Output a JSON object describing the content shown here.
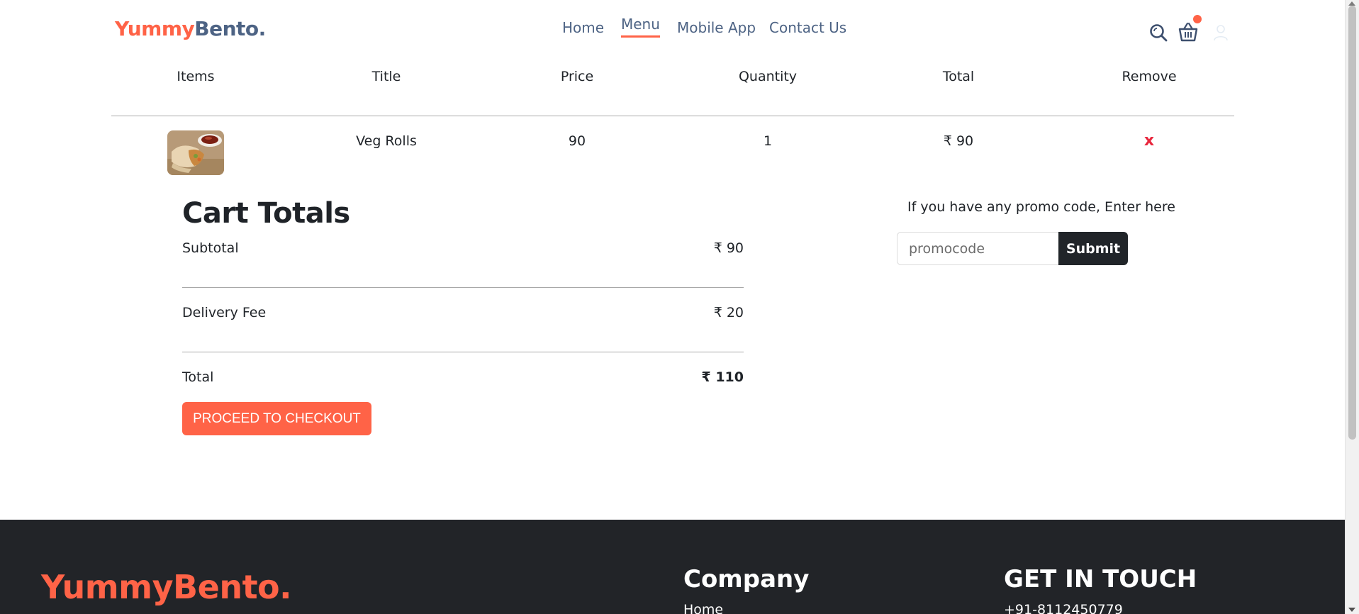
{
  "brand": {
    "name_part1": "Yummy",
    "name_part2": "Bento.",
    "accent": "#ff6347",
    "secondary": "#4d6384"
  },
  "nav": {
    "items": [
      {
        "label": "Home"
      },
      {
        "label": "Menu",
        "active": true
      },
      {
        "label": "Mobile App"
      },
      {
        "label": "Contact Us"
      }
    ],
    "icons": [
      "search-icon",
      "basket-icon",
      "user-icon"
    ],
    "cart_has_items": true
  },
  "cart": {
    "headers": [
      "Items",
      "Title",
      "Price",
      "Quantity",
      "Total",
      "Remove"
    ],
    "rows": [
      {
        "image": "veg-rolls-photo",
        "title": "Veg Rolls",
        "price": "90",
        "quantity": "1",
        "total": "₹ 90",
        "remove": "x"
      }
    ]
  },
  "totals": {
    "title": "Cart Totals",
    "subtotal_label": "Subtotal",
    "subtotal_value": "₹ 90",
    "delivery_label": "Delivery Fee",
    "delivery_value": "₹ 20",
    "total_label": "Total",
    "total_value": "₹ 110",
    "checkout_label": "PROCEED TO CHECKOUT"
  },
  "promo": {
    "prompt": "If you have any promo code, Enter here",
    "placeholder": "promocode",
    "submit_label": "Submit"
  },
  "footer": {
    "logo": "YummyBento.",
    "company_heading": "Company",
    "company_links": [
      "Home"
    ],
    "contact_heading": "GET IN TOUCH",
    "phone": "+91-8112450779"
  }
}
